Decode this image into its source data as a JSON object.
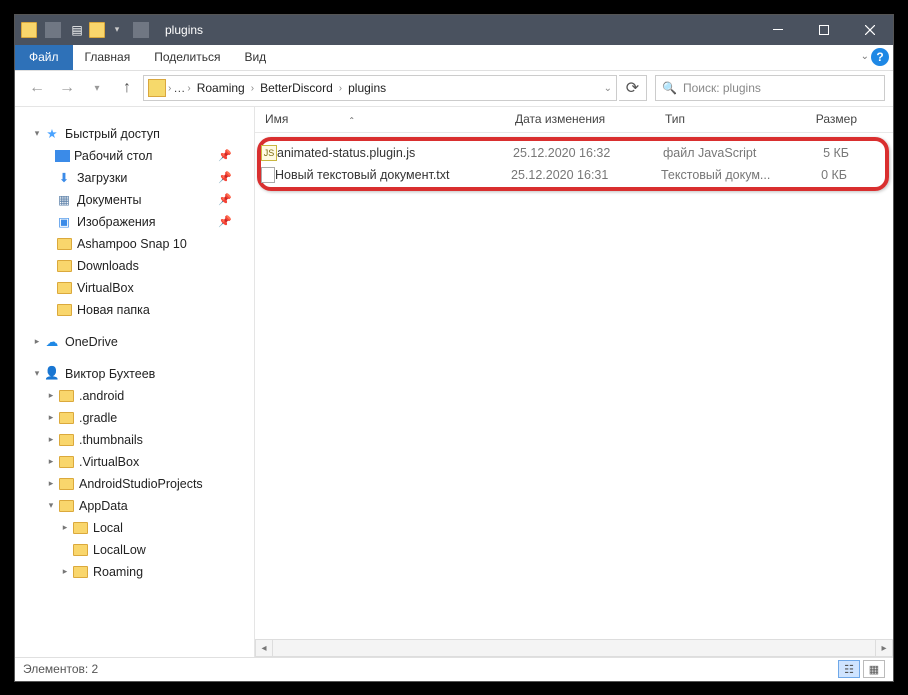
{
  "title": "plugins",
  "menu": {
    "file": "Файл",
    "home": "Главная",
    "share": "Поделиться",
    "view": "Вид"
  },
  "breadcrumb": [
    "Roaming",
    "BetterDiscord",
    "plugins"
  ],
  "search_placeholder": "Поиск: plugins",
  "columns": {
    "name": "Имя",
    "date": "Дата изменения",
    "type": "Тип",
    "size": "Размер"
  },
  "files": [
    {
      "name": "animated-status.plugin.js",
      "date": "25.12.2020 16:32",
      "type": "файл JavaScript",
      "size": "5 КБ"
    },
    {
      "name": "Новый текстовый документ.txt",
      "date": "25.12.2020 16:31",
      "type": "Текстовый докум...",
      "size": "0 КБ"
    }
  ],
  "sidebar": {
    "quick_access": "Быстрый доступ",
    "pinned": [
      "Рабочий стол",
      "Загрузки",
      "Документы",
      "Изображения"
    ],
    "qa_folders": [
      "Ashampoo Snap 10",
      "Downloads",
      "VirtualBox",
      "Новая папка"
    ],
    "onedrive": "OneDrive",
    "user": "Виктор Бухтеев",
    "user_folders": [
      ".android",
      ".gradle",
      ".thumbnails",
      ".VirtualBox",
      "AndroidStudioProjects",
      "AppData"
    ],
    "appdata": [
      "Local",
      "LocalLow",
      "Roaming"
    ]
  },
  "status": "Элементов: 2"
}
